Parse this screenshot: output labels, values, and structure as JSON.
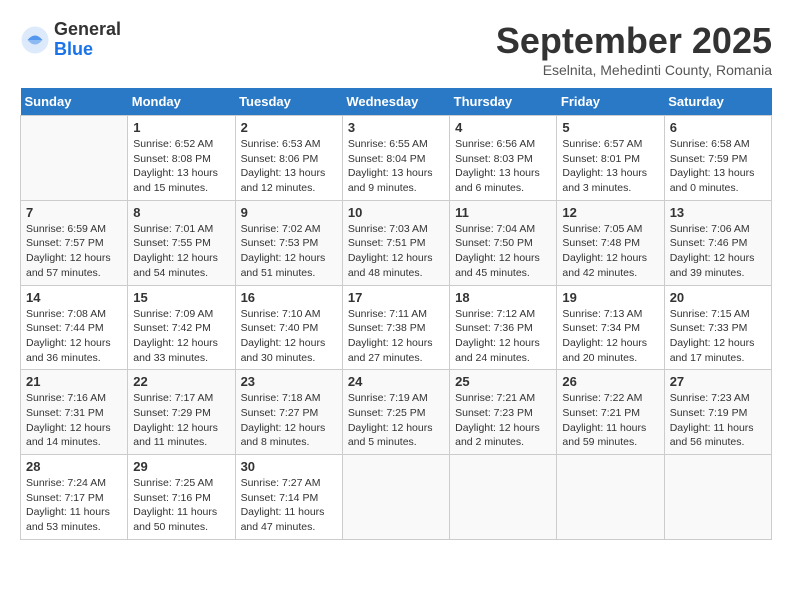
{
  "logo": {
    "general": "General",
    "blue": "Blue"
  },
  "title": "September 2025",
  "subtitle": "Eselnita, Mehedinti County, Romania",
  "days_header": [
    "Sunday",
    "Monday",
    "Tuesday",
    "Wednesday",
    "Thursday",
    "Friday",
    "Saturday"
  ],
  "weeks": [
    [
      {
        "day": "",
        "info": ""
      },
      {
        "day": "1",
        "info": "Sunrise: 6:52 AM\nSunset: 8:08 PM\nDaylight: 13 hours\nand 15 minutes."
      },
      {
        "day": "2",
        "info": "Sunrise: 6:53 AM\nSunset: 8:06 PM\nDaylight: 13 hours\nand 12 minutes."
      },
      {
        "day": "3",
        "info": "Sunrise: 6:55 AM\nSunset: 8:04 PM\nDaylight: 13 hours\nand 9 minutes."
      },
      {
        "day": "4",
        "info": "Sunrise: 6:56 AM\nSunset: 8:03 PM\nDaylight: 13 hours\nand 6 minutes."
      },
      {
        "day": "5",
        "info": "Sunrise: 6:57 AM\nSunset: 8:01 PM\nDaylight: 13 hours\nand 3 minutes."
      },
      {
        "day": "6",
        "info": "Sunrise: 6:58 AM\nSunset: 7:59 PM\nDaylight: 13 hours\nand 0 minutes."
      }
    ],
    [
      {
        "day": "7",
        "info": "Sunrise: 6:59 AM\nSunset: 7:57 PM\nDaylight: 12 hours\nand 57 minutes."
      },
      {
        "day": "8",
        "info": "Sunrise: 7:01 AM\nSunset: 7:55 PM\nDaylight: 12 hours\nand 54 minutes."
      },
      {
        "day": "9",
        "info": "Sunrise: 7:02 AM\nSunset: 7:53 PM\nDaylight: 12 hours\nand 51 minutes."
      },
      {
        "day": "10",
        "info": "Sunrise: 7:03 AM\nSunset: 7:51 PM\nDaylight: 12 hours\nand 48 minutes."
      },
      {
        "day": "11",
        "info": "Sunrise: 7:04 AM\nSunset: 7:50 PM\nDaylight: 12 hours\nand 45 minutes."
      },
      {
        "day": "12",
        "info": "Sunrise: 7:05 AM\nSunset: 7:48 PM\nDaylight: 12 hours\nand 42 minutes."
      },
      {
        "day": "13",
        "info": "Sunrise: 7:06 AM\nSunset: 7:46 PM\nDaylight: 12 hours\nand 39 minutes."
      }
    ],
    [
      {
        "day": "14",
        "info": "Sunrise: 7:08 AM\nSunset: 7:44 PM\nDaylight: 12 hours\nand 36 minutes."
      },
      {
        "day": "15",
        "info": "Sunrise: 7:09 AM\nSunset: 7:42 PM\nDaylight: 12 hours\nand 33 minutes."
      },
      {
        "day": "16",
        "info": "Sunrise: 7:10 AM\nSunset: 7:40 PM\nDaylight: 12 hours\nand 30 minutes."
      },
      {
        "day": "17",
        "info": "Sunrise: 7:11 AM\nSunset: 7:38 PM\nDaylight: 12 hours\nand 27 minutes."
      },
      {
        "day": "18",
        "info": "Sunrise: 7:12 AM\nSunset: 7:36 PM\nDaylight: 12 hours\nand 24 minutes."
      },
      {
        "day": "19",
        "info": "Sunrise: 7:13 AM\nSunset: 7:34 PM\nDaylight: 12 hours\nand 20 minutes."
      },
      {
        "day": "20",
        "info": "Sunrise: 7:15 AM\nSunset: 7:33 PM\nDaylight: 12 hours\nand 17 minutes."
      }
    ],
    [
      {
        "day": "21",
        "info": "Sunrise: 7:16 AM\nSunset: 7:31 PM\nDaylight: 12 hours\nand 14 minutes."
      },
      {
        "day": "22",
        "info": "Sunrise: 7:17 AM\nSunset: 7:29 PM\nDaylight: 12 hours\nand 11 minutes."
      },
      {
        "day": "23",
        "info": "Sunrise: 7:18 AM\nSunset: 7:27 PM\nDaylight: 12 hours\nand 8 minutes."
      },
      {
        "day": "24",
        "info": "Sunrise: 7:19 AM\nSunset: 7:25 PM\nDaylight: 12 hours\nand 5 minutes."
      },
      {
        "day": "25",
        "info": "Sunrise: 7:21 AM\nSunset: 7:23 PM\nDaylight: 12 hours\nand 2 minutes."
      },
      {
        "day": "26",
        "info": "Sunrise: 7:22 AM\nSunset: 7:21 PM\nDaylight: 11 hours\nand 59 minutes."
      },
      {
        "day": "27",
        "info": "Sunrise: 7:23 AM\nSunset: 7:19 PM\nDaylight: 11 hours\nand 56 minutes."
      }
    ],
    [
      {
        "day": "28",
        "info": "Sunrise: 7:24 AM\nSunset: 7:17 PM\nDaylight: 11 hours\nand 53 minutes."
      },
      {
        "day": "29",
        "info": "Sunrise: 7:25 AM\nSunset: 7:16 PM\nDaylight: 11 hours\nand 50 minutes."
      },
      {
        "day": "30",
        "info": "Sunrise: 7:27 AM\nSunset: 7:14 PM\nDaylight: 11 hours\nand 47 minutes."
      },
      {
        "day": "",
        "info": ""
      },
      {
        "day": "",
        "info": ""
      },
      {
        "day": "",
        "info": ""
      },
      {
        "day": "",
        "info": ""
      }
    ]
  ]
}
